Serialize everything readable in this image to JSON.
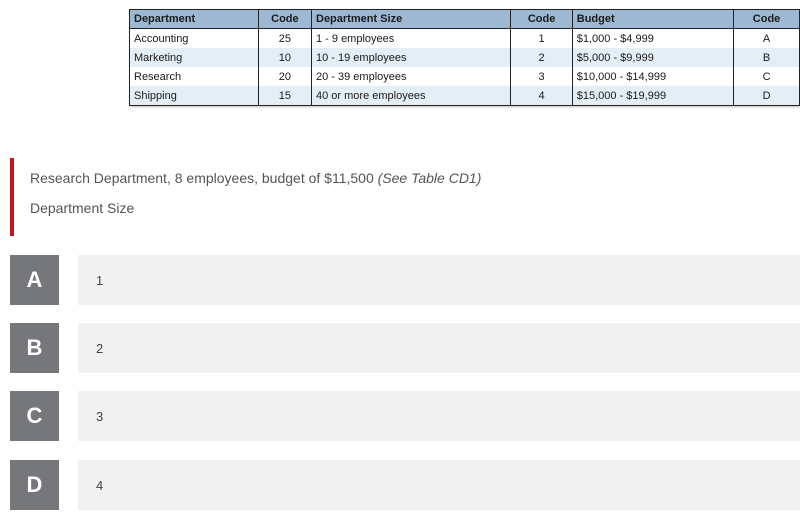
{
  "table": {
    "headers": [
      "Department",
      "Code",
      "Department Size",
      "Code",
      "Budget",
      "Code"
    ],
    "rows": [
      [
        "Accounting",
        "25",
        "1 - 9 employees",
        "1",
        "$1,000 - $4,999",
        "A"
      ],
      [
        "Marketing",
        "10",
        "10 - 19 employees",
        "2",
        "$5,000 - $9,999",
        "B"
      ],
      [
        "Research",
        "20",
        "20 - 39 employees",
        "3",
        "$10,000 - $14,999",
        "C"
      ],
      [
        "Shipping",
        "15",
        "40 or more employees",
        "4",
        "$15,000 - $19,999",
        "D"
      ]
    ]
  },
  "question": {
    "stem": "Research Department, 8 employees, budget of $11,500 ",
    "stem_ref": "(See Table CD1)",
    "prompt": "Department Size"
  },
  "choices": [
    {
      "letter": "A",
      "text": "1"
    },
    {
      "letter": "B",
      "text": "2"
    },
    {
      "letter": "C",
      "text": "3"
    },
    {
      "letter": "D",
      "text": "4"
    }
  ],
  "colors": {
    "accent_bar": "#c4161c",
    "letter_tile": "#75777b",
    "answer_bg": "#f1f1f1",
    "table_header": "#9db8d3",
    "table_stripe": "#e4eef7"
  }
}
